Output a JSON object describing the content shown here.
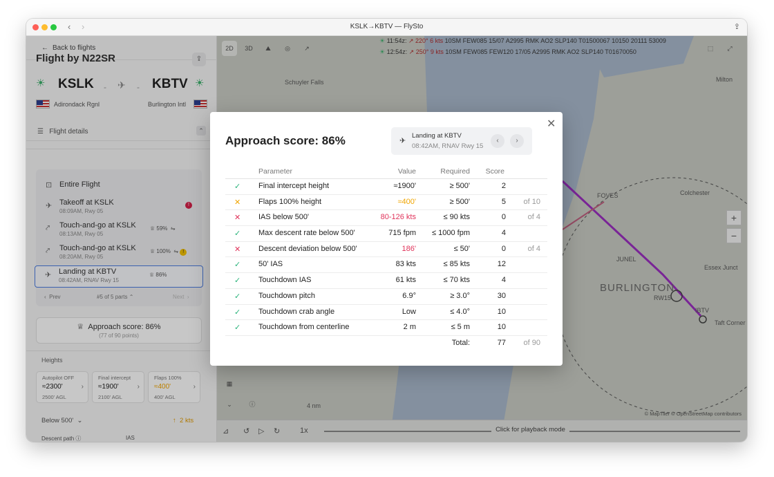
{
  "window": {
    "title": "KSLK→KBTV — FlySto"
  },
  "sidebar": {
    "back": "Back to flights",
    "flight_by": "Flight by N22SR",
    "from": {
      "code": "KSLK",
      "name": "Adirondack Rgnl"
    },
    "to": {
      "code": "KBTV",
      "name": "Burlington Intl"
    },
    "flight_details": "Flight details",
    "entire_flight": "Entire Flight",
    "parts": [
      {
        "title": "Takeoff at KSLK",
        "sub": "08:09AM, Rwy 05",
        "score": ""
      },
      {
        "title": "Touch-and-go at KSLK",
        "sub": "08:13AM, Rwy 05",
        "score": "59%"
      },
      {
        "title": "Touch-and-go at KSLK",
        "sub": "08:20AM, Rwy 05",
        "score": "100%"
      },
      {
        "title": "Landing at KBTV",
        "sub": "08:42AM, RNAV Rwy 15",
        "score": "86%"
      }
    ],
    "prev": "Prev",
    "part_of": "#5 of 5 parts",
    "next": "Next",
    "approach_score": "Approach score: 86%",
    "points": "(77 of 90 points)",
    "heights": "Heights",
    "cards": [
      {
        "label": "Autopilot OFF",
        "value": "≈2300'",
        "agl": "2500' AGL"
      },
      {
        "label": "Final intercept",
        "value": "≈1900'",
        "agl": "2100' AGL"
      },
      {
        "label": "Flaps 100%",
        "value": "≈400'",
        "agl": "400' AGL"
      }
    ],
    "below500": "Below 500'",
    "below500_right": "2 kts",
    "descent_path": "Descent path",
    "ias": "IAS"
  },
  "map": {
    "btn_2d": "2D",
    "btn_3d": "3D",
    "metar1_time": "11:54z:",
    "metar1_wind": "220° 6 kts",
    "metar1_rest": "10SM FEW085 15/07 A2995 RMK AO2 SLP140 T01500067 10150 20111 53009",
    "metar2_time": "12:54z:",
    "metar2_wind": "250° 9 kts",
    "metar2_rest": "10SM FEW085 FEW120 17/05 A2995 RMK AO2 SLP140 T01670050",
    "labels": {
      "schuyler": "Schuyler Falls",
      "milton": "Milton",
      "colchester": "Colchester",
      "essex": "Essex Junct",
      "burlington": "BURLINGTON",
      "taft": "Taft Corner",
      "foves": "FOVES",
      "junel": "JUNEL",
      "rw15": "RW15",
      "ibtv": "IBTV",
      "scale": "4 nm"
    },
    "attribution": "© MapTiler © OpenStreetMap contributors",
    "playback": "Click for playback mode",
    "speed": "1x"
  },
  "modal": {
    "title": "Approach score: 86%",
    "landing_title": "Landing at KBTV",
    "landing_sub": "08:42AM, RNAV Rwy 15",
    "headers": {
      "parameter": "Parameter",
      "value": "Value",
      "required": "Required",
      "score": "Score"
    },
    "rows": [
      {
        "status": "ok",
        "param": "Final intercept height",
        "value": "≈1900'",
        "vclass": "",
        "required": "≥ 500'",
        "score": "2",
        "of": ""
      },
      {
        "status": "warn",
        "param": "Flaps 100% height",
        "value": "≈400'",
        "vclass": "orange",
        "required": "≥ 500'",
        "score": "5",
        "of": "of 10"
      },
      {
        "status": "x",
        "param": "IAS below 500'",
        "value": "80-126 kts",
        "vclass": "red",
        "required": "≤ 90 kts",
        "score": "0",
        "of": "of 4"
      },
      {
        "status": "ok",
        "param": "Max descent rate below 500'",
        "value": "715 fpm",
        "vclass": "",
        "required": "≤ 1000 fpm",
        "score": "4",
        "of": ""
      },
      {
        "status": "x",
        "param": "Descent deviation below 500'",
        "value": "186'",
        "vclass": "red",
        "required": "≤ 50'",
        "score": "0",
        "of": "of 4"
      },
      {
        "status": "ok",
        "param": "50' IAS",
        "value": "83 kts",
        "vclass": "",
        "required": "≤ 85 kts",
        "score": "12",
        "of": ""
      },
      {
        "status": "ok",
        "param": "Touchdown IAS",
        "value": "61 kts",
        "vclass": "",
        "required": "≤ 70 kts",
        "score": "4",
        "of": ""
      },
      {
        "status": "ok",
        "param": "Touchdown pitch",
        "value": "6.9°",
        "vclass": "",
        "required": "≥ 3.0°",
        "score": "30",
        "of": ""
      },
      {
        "status": "ok",
        "param": "Touchdown crab angle",
        "value": "Low",
        "vclass": "",
        "required": "≤ 4.0°",
        "score": "10",
        "of": ""
      },
      {
        "status": "ok",
        "param": "Touchdown from centerline",
        "value": "2 m",
        "vclass": "",
        "required": "≤ 5 m",
        "score": "10",
        "of": ""
      }
    ],
    "total_label": "Total:",
    "total_score": "77",
    "total_of": "of 90"
  },
  "colors": {
    "ok": "#29b37a",
    "fail": "#e0335a",
    "warn": "#f0a500",
    "accent": "#4a7ce0",
    "track": "#9b2fc0"
  }
}
